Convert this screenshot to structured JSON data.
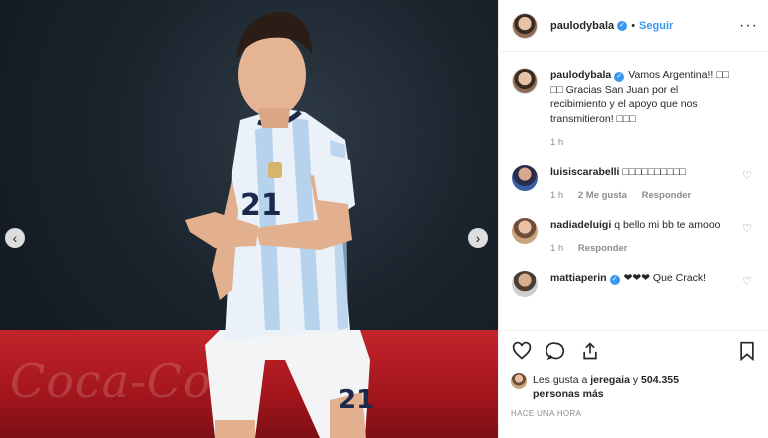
{
  "post": {
    "author": {
      "username": "paulodybala",
      "verified_icon": "verified-badge-icon",
      "follow_label": "Seguir",
      "dot": "•",
      "more_label": "···"
    },
    "photo": {
      "banner_text": "Coca-Cola",
      "jersey_number": "21",
      "nav_left_icon": "chevron-left-icon",
      "nav_right_icon": "chevron-right-icon",
      "nav_left": "‹",
      "nav_right": "›"
    },
    "caption": {
      "username": "paulodybala",
      "text": "Vamos Argentina!! □□ □□ Gracias San Juan por el recibimiento y el apoyo que nos transmitieron! □□□",
      "time": "1 h"
    },
    "comments": [
      {
        "username": "luisiscarabelli",
        "text": "□□□□□□□□□□",
        "time": "1 h",
        "likes": "2 Me gusta",
        "reply": "Responder"
      },
      {
        "username": "nadiadeluigi",
        "text": "q bello mi bb te amooo",
        "time": "1 h",
        "reply": "Responder"
      },
      {
        "username": "mattiaperin",
        "text": "❤❤❤ Que Crack!",
        "time": "",
        "reply": ""
      }
    ],
    "likes": {
      "prefix": "Les gusta a ",
      "user": "jeregaia",
      "middle": " y ",
      "count": "504.355 personas más"
    },
    "timestamp": "HACE UNA HORA"
  },
  "colors": {
    "link": "#3897f0",
    "muted": "#8e8e8e",
    "text": "#262626",
    "banner": "#c3252c"
  }
}
